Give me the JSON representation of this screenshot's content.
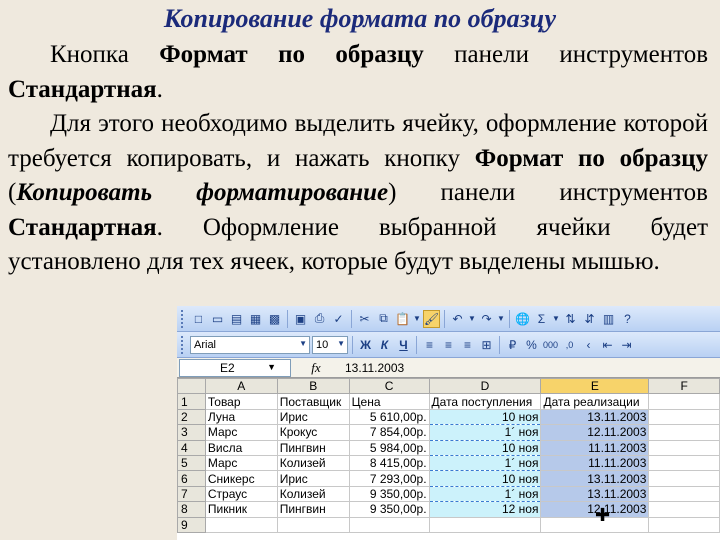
{
  "title": "Копирование формата по образцу",
  "paragraph1": {
    "t1": "Кнопка ",
    "b1": "Формат по образцу",
    "t2": " панели инструментов ",
    "b2": "Стандартная",
    "t3": "."
  },
  "paragraph2": {
    "t1": "Для этого необходимо выделить ячейку, оформление которой требуется копировать, и нажать кнопку ",
    "b1": "Формат по образцу",
    "t2": " (",
    "bi1": "Копировать форматирование",
    "t3": ") панели инструментов ",
    "b2": "Стандартная",
    "t4": ". Оформление выбранной ячейки будет установлено для тех ячеек, которые будут выделены мышью."
  },
  "excel": {
    "font_name": "Arial",
    "font_size": "10",
    "name_box": "E2",
    "fx_label": "fx",
    "formula_value": "13.11.2003",
    "toolbar_glyphs": [
      "□",
      "▭",
      "▤",
      "▦",
      "▩",
      "▣",
      "✓",
      "⎙",
      "✂",
      "⧉",
      "📋",
      "🖌",
      "↶",
      "↷",
      "🌐",
      "Σ",
      "⇅",
      "⇵",
      "▥",
      "?"
    ],
    "format_glyphs": [
      "Ж",
      "К",
      "Ч",
      "≡",
      "≡",
      "≡",
      "⊞",
      "%",
      "000",
      ",0",
      "‹",
      "›",
      "⇤",
      "⇥"
    ],
    "col_headers": [
      "A",
      "B",
      "C",
      "D",
      "E",
      "F"
    ],
    "row_headers": [
      "1",
      "2",
      "3",
      "4",
      "5",
      "6",
      "7",
      "8",
      "9"
    ],
    "rows": [
      [
        "Товар",
        "Поставщик",
        "Цена",
        "Дата поступления",
        "Дата реализации",
        ""
      ],
      [
        "Луна",
        "Ирис",
        "5 610,00р.",
        "10 ноя",
        "13.11.2003",
        ""
      ],
      [
        "Марс",
        "Крокус",
        "7 854,00р.",
        "1´ ноя",
        "12.11.2003",
        ""
      ],
      [
        "Висла",
        "Пингвин",
        "5 984,00р.",
        "10 ноя",
        "11.11.2003",
        ""
      ],
      [
        "Марс",
        "Колизей",
        "8 415,00р.",
        "1´ ноя",
        "11.11.2003",
        ""
      ],
      [
        "Сникерс",
        "Ирис",
        "7 293,00р.",
        "10 ноя",
        "13.11.2003",
        ""
      ],
      [
        "Страус",
        "Колизей",
        "9 350,00р.",
        "1´ ноя",
        "13.11.2003",
        ""
      ],
      [
        "Пикник",
        "Пингвин",
        "9 350,00р.",
        "12 ноя",
        "12.11.2003",
        ""
      ],
      [
        "",
        "",
        "",
        "",
        "",
        ""
      ]
    ]
  }
}
